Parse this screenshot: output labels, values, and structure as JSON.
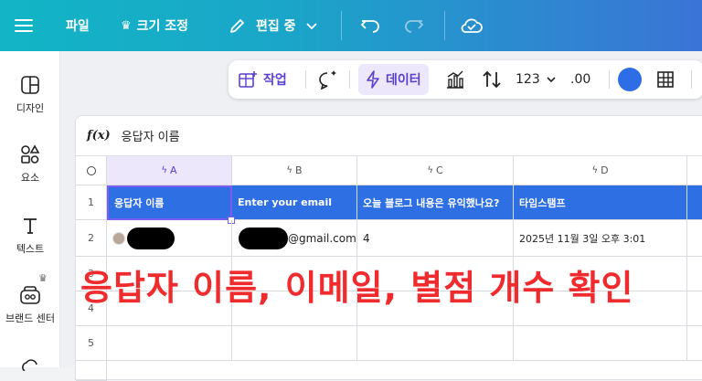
{
  "topbar": {
    "file": "파일",
    "resize": "크기 조정",
    "editing": "편집 중"
  },
  "sidebar": {
    "items": [
      {
        "label": "디자인",
        "icon": "design-icon"
      },
      {
        "label": "요소",
        "icon": "elements-icon"
      },
      {
        "label": "텍스트",
        "icon": "text-icon"
      },
      {
        "label": "브랜드 센터",
        "icon": "brand-icon"
      }
    ]
  },
  "toolbar": {
    "action": "작업",
    "data": "데이터",
    "number_format": "123",
    "decimal": ".00",
    "accent_color": "#2d6ee6"
  },
  "formula_bar": {
    "fx": "f(x)",
    "value": "응답자 이름"
  },
  "sheet": {
    "columns": [
      "A",
      "B",
      "C",
      "D"
    ],
    "rows": [
      "1",
      "2",
      "3",
      "4",
      "5"
    ],
    "headers": [
      "응답자 이름",
      "Enter your email",
      "오늘 블로그 내용은 유익했나요?",
      "타임스탬프"
    ],
    "row2": {
      "email_suffix": "@gmail.com",
      "rating": "4",
      "timestamp": "2025년 11월 3일 오후 3:01"
    }
  },
  "overlay_caption": "응답자 이름, 이메일, 별점 개수 확인",
  "colors": {
    "header_blue": "#2e6fe3",
    "overlay_red": "#ef2b2d",
    "selected_col": "#ede7fb"
  }
}
